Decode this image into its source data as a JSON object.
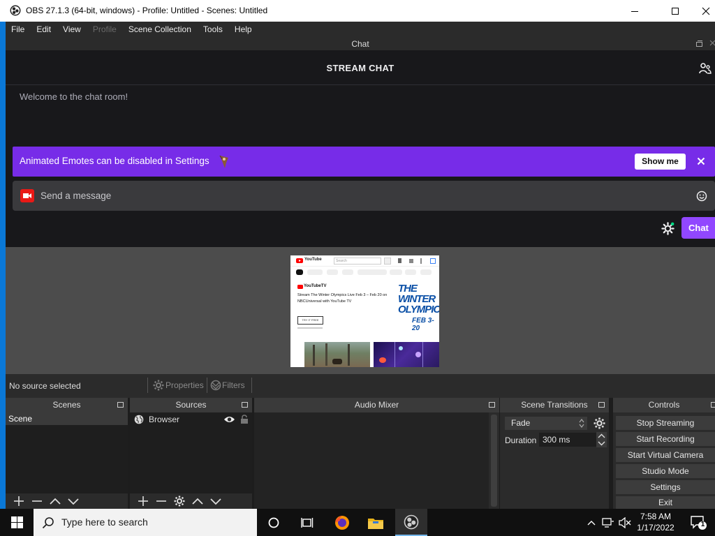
{
  "window": {
    "title": "OBS 27.1.3 (64-bit, windows) - Profile: Untitled - Scenes: Untitled"
  },
  "menu": {
    "items": [
      {
        "label": "File",
        "enabled": true
      },
      {
        "label": "Edit",
        "enabled": true
      },
      {
        "label": "View",
        "enabled": true
      },
      {
        "label": "Profile",
        "enabled": false
      },
      {
        "label": "Scene Collection",
        "enabled": true
      },
      {
        "label": "Tools",
        "enabled": true
      },
      {
        "label": "Help",
        "enabled": true
      }
    ]
  },
  "chat_dock": {
    "title": "Chat",
    "header_title": "STREAM CHAT",
    "welcome": "Welcome to the chat room!",
    "banner_text": "Animated Emotes can be disabled in Settings",
    "banner_button": "Show me",
    "message_placeholder": "Send a message",
    "chat_button": "Chat"
  },
  "preview": {
    "youtube_search": "Search",
    "youtube_tv_label": "YouTubeTV",
    "headline": "Stream The Winter Olympics Live Feb 3 – Feb 20 on NBCUniversal with YouTube TV",
    "promo_title": "THE WINTER OLYMPIC",
    "promo_dates": "FEB 3-20",
    "cta": "TRY IT FREE"
  },
  "source_toolbar": {
    "status": "No source selected",
    "properties": "Properties",
    "filters": "Filters"
  },
  "docks": {
    "scenes": {
      "title": "Scenes",
      "items": [
        "Scene"
      ]
    },
    "sources": {
      "title": "Sources",
      "items": [
        "Browser"
      ]
    },
    "audio_mixer": {
      "title": "Audio Mixer"
    },
    "transitions": {
      "title": "Scene Transitions",
      "transition": "Fade",
      "duration_label": "Duration",
      "duration": "300 ms"
    },
    "controls": {
      "title": "Controls",
      "buttons": [
        "Stop Streaming",
        "Start Recording",
        "Start Virtual Camera",
        "Studio Mode",
        "Settings",
        "Exit"
      ]
    }
  },
  "taskbar": {
    "search_placeholder": "Type here to search",
    "time": "7:58 AM",
    "date": "1/17/2022",
    "notification_count": "1"
  },
  "colors": {
    "accent_purple": "#772ce8",
    "chat_button": "#9147ff",
    "preview_bg": "#4c4c4c",
    "windows_blue": "#0a78d7"
  }
}
